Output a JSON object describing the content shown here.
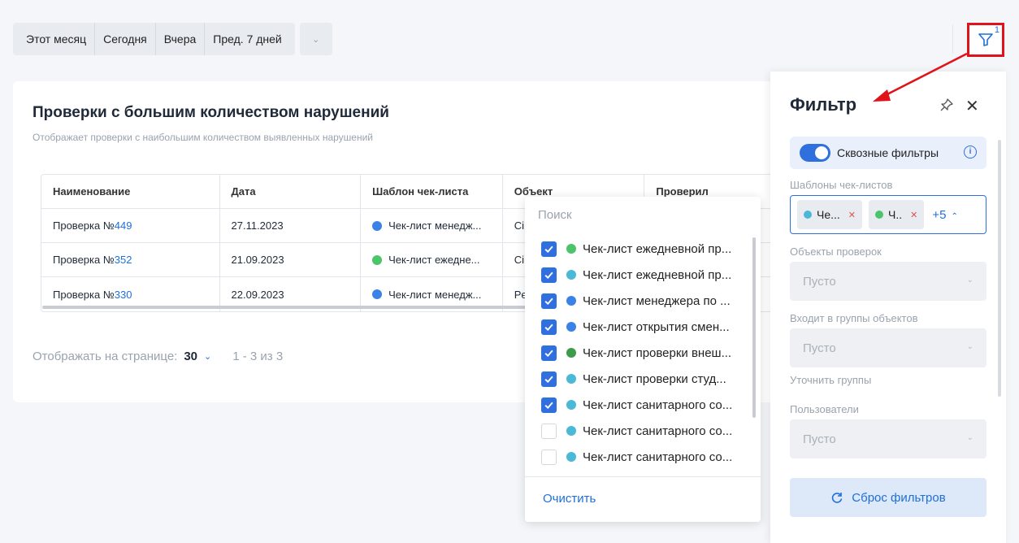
{
  "datebar": {
    "presets": [
      "Этот месяц",
      "Сегодня",
      "Вчера",
      "Пред. 7 дней"
    ]
  },
  "filter_toggle": {
    "badge": "1"
  },
  "card": {
    "title": "Проверки с большим количеством нарушений",
    "subtitle": "Отображает проверки с наибольшим количеством выявленных нарушений"
  },
  "table": {
    "headers": [
      "Наименование",
      "Дата",
      "Шаблон чек-листа",
      "Объект",
      "Проверил"
    ],
    "rows": [
      {
        "name_prefix": "Проверка №",
        "name_num": "449",
        "date": "27.11.2023",
        "template": "Чек-лист менедж...",
        "template_color": "#3b82e6",
        "object": "Сі"
      },
      {
        "name_prefix": "Проверка №",
        "name_num": "352",
        "date": "21.09.2023",
        "template": "Чек-лист ежедне...",
        "template_color": "#4cc46a",
        "object": "Сі"
      },
      {
        "name_prefix": "Проверка №",
        "name_num": "330",
        "date": "22.09.2023",
        "template": "Чек-лист менедж...",
        "template_color": "#3b82e6",
        "object": "Рє"
      }
    ]
  },
  "pager": {
    "label": "Отображать на странице:",
    "per_page": "30",
    "range": "1 - 3 из 3"
  },
  "dropdown": {
    "search_placeholder": "Поиск",
    "items": [
      {
        "label": "Чек-лист ежедневной пр...",
        "checked": true,
        "color": "#4cc46a"
      },
      {
        "label": "Чек-лист ежедневной пр...",
        "checked": true,
        "color": "#4bb8d6"
      },
      {
        "label": "Чек-лист менеджера по ...",
        "checked": true,
        "color": "#3b82e6"
      },
      {
        "label": "Чек-лист открытия смен...",
        "checked": true,
        "color": "#3b82e6"
      },
      {
        "label": "Чек-лист проверки внеш...",
        "checked": true,
        "color": "#3d9c4a"
      },
      {
        "label": "Чек-лист проверки студ...",
        "checked": true,
        "color": "#4bb8d6"
      },
      {
        "label": "Чек-лист санитарного со...",
        "checked": true,
        "color": "#4bb8d6"
      },
      {
        "label": "Чек-лист санитарного со...",
        "checked": false,
        "color": "#4bb8d6"
      },
      {
        "label": "Чек-лист санитарного со...",
        "checked": false,
        "color": "#4bb8d6"
      }
    ],
    "clear_label": "Очистить"
  },
  "panel": {
    "title": "Фильтр",
    "through_filters": "Сквозные фильтры",
    "templates_label": "Шаблоны чек-листов",
    "tags": [
      {
        "label": "Че...",
        "color": "#4bb8d6"
      },
      {
        "label": "Ч..",
        "color": "#4cc46a"
      }
    ],
    "more_count": "+5",
    "objects_label": "Объекты проверок",
    "groups_label": "Входит в группы объектов",
    "refine_groups": "Уточнить группы",
    "users_label": "Пользователи",
    "empty": "Пусто",
    "reset_label": "Сброс фильтров"
  },
  "colors": {
    "accent": "#2f6fde",
    "link": "#1e6fd9",
    "highlight": "#e0121b"
  }
}
